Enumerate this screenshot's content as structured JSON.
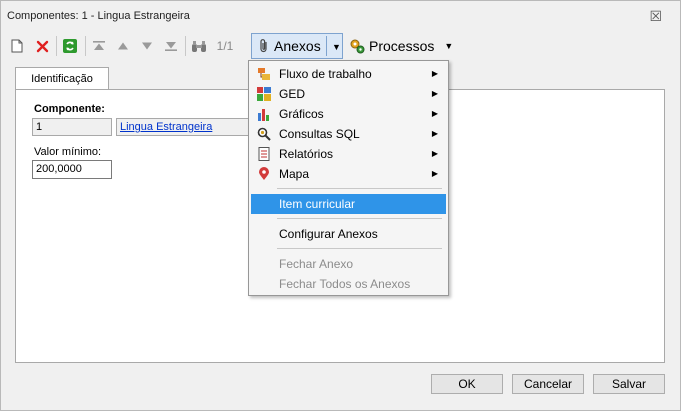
{
  "window": {
    "title": "Componentes: 1 - Lingua Estrangeira",
    "close_glyph": "☒"
  },
  "toolbar": {
    "record_position": "1/1",
    "anexos_label": "Anexos",
    "processos_label": "Processos"
  },
  "tabs": [
    {
      "label": "Identificação"
    }
  ],
  "form": {
    "componente_label": "Componente:",
    "componente_code": "1",
    "componente_name": "Lingua Estrangeira",
    "valor_minimo_label": "Valor mínimo:",
    "valor_minimo_value": "200,0000"
  },
  "buttons": {
    "ok": "OK",
    "cancel": "Cancelar",
    "save": "Salvar"
  },
  "menu": {
    "items": [
      {
        "label": "Fluxo de trabalho",
        "submenu": true,
        "icon": "workflow-icon"
      },
      {
        "label": "GED",
        "submenu": true,
        "icon": "ged-icon"
      },
      {
        "label": "Gráficos",
        "submenu": true,
        "icon": "chart-icon"
      },
      {
        "label": "Consultas SQL",
        "submenu": true,
        "icon": "sql-query-icon"
      },
      {
        "label": "Relatórios",
        "submenu": true,
        "icon": "report-icon"
      },
      {
        "label": "Mapa",
        "submenu": true,
        "icon": "map-pin-icon"
      },
      {
        "label": "Item curricular",
        "highlighted": true
      },
      {
        "label": "Configurar Anexos"
      },
      {
        "label": "Fechar Anexo",
        "disabled": true
      },
      {
        "label": "Fechar Todos os Anexos",
        "disabled": true
      }
    ]
  },
  "colors": {
    "highlight": "#2f94e8",
    "link": "#0033cc",
    "delete_red": "#e02020",
    "refresh_green": "#2e9a2e"
  }
}
